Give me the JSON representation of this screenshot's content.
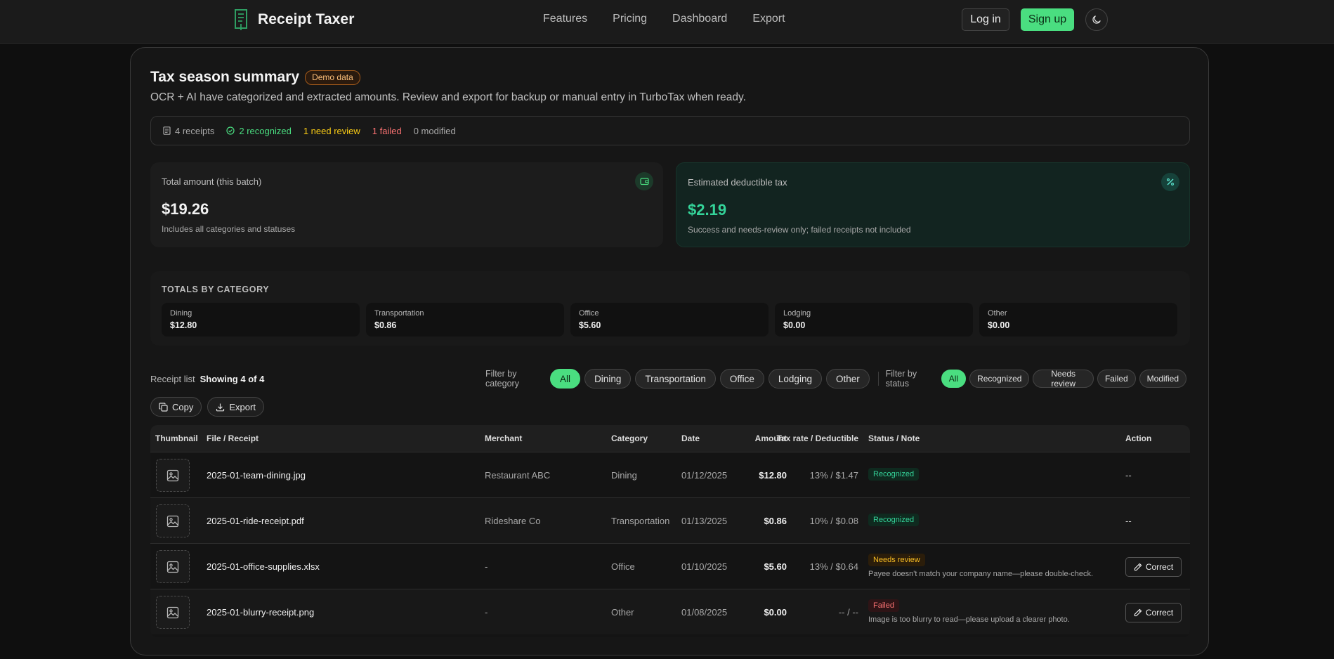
{
  "nav": {
    "brand": "Receipt Taxer",
    "links": [
      "Features",
      "Pricing",
      "Dashboard",
      "Export"
    ],
    "login": "Log in",
    "signup": "Sign up"
  },
  "summary": {
    "title": "Tax season summary",
    "badge": "Demo data",
    "subtitle": "OCR + AI have categorized and extracted amounts. Review and export for backup or manual entry in TurboTax when ready.",
    "stats": {
      "receipts": "4 receipts",
      "recognized": "2 recognized",
      "review": "1 need review",
      "failed": "1 failed",
      "modified": "0 modified"
    }
  },
  "metrics": {
    "total": {
      "label": "Total amount (this batch)",
      "value": "$19.26",
      "note": "Includes all categories and statuses"
    },
    "tax": {
      "label": "Estimated deductible tax",
      "value": "$2.19",
      "note": "Success and needs-review only; failed receipts not included"
    }
  },
  "categories": {
    "heading": "TOTALS BY CATEGORY",
    "items": [
      {
        "name": "Dining",
        "amount": "$12.80"
      },
      {
        "name": "Transportation",
        "amount": "$0.86"
      },
      {
        "name": "Office",
        "amount": "$5.60"
      },
      {
        "name": "Lodging",
        "amount": "$0.00"
      },
      {
        "name": "Other",
        "amount": "$0.00"
      }
    ]
  },
  "list": {
    "label": "Receipt list",
    "showing": "Showing 4 of 4",
    "filter_category_label": "Filter by category",
    "category_filters": [
      "All",
      "Dining",
      "Transportation",
      "Office",
      "Lodging",
      "Other"
    ],
    "filter_status_label": "Filter by status",
    "status_filters": [
      "All",
      "Recognized",
      "Needs review",
      "Failed",
      "Modified"
    ],
    "copy": "Copy",
    "export": "Export"
  },
  "table": {
    "headers": {
      "thumbnail": "Thumbnail",
      "file": "File / Receipt",
      "merchant": "Merchant",
      "category": "Category",
      "date": "Date",
      "amount": "Amount",
      "tax": "Tax rate / Deductible",
      "status": "Status / Note",
      "action": "Action"
    },
    "rows": [
      {
        "file": "2025-01-team-dining.jpg",
        "merchant": "Restaurant ABC",
        "category": "Dining",
        "date": "01/12/2025",
        "amount": "$12.80",
        "tax": "13% / $1.47",
        "status": "Recognized",
        "note": "",
        "action": "--"
      },
      {
        "file": "2025-01-ride-receipt.pdf",
        "merchant": "Rideshare Co",
        "category": "Transportation",
        "date": "01/13/2025",
        "amount": "$0.86",
        "tax": "10% / $0.08",
        "status": "Recognized",
        "note": "",
        "action": "--"
      },
      {
        "file": "2025-01-office-supplies.xlsx",
        "merchant": "-",
        "category": "Office",
        "date": "01/10/2025",
        "amount": "$5.60",
        "tax": "13% / $0.64",
        "status": "Needs review",
        "note": "Payee doesn't match your company name—please double-check.",
        "action": "Correct"
      },
      {
        "file": "2025-01-blurry-receipt.png",
        "merchant": "-",
        "category": "Other",
        "date": "01/08/2025",
        "amount": "$0.00",
        "tax": "-- / --",
        "status": "Failed",
        "note": "Image is too blurry to read—please upload a clearer photo.",
        "action": "Correct"
      }
    ]
  },
  "colors": {
    "accent": "#4ade80",
    "recognized": "#34d399",
    "review": "#fbbf24",
    "failed": "#f87171"
  }
}
